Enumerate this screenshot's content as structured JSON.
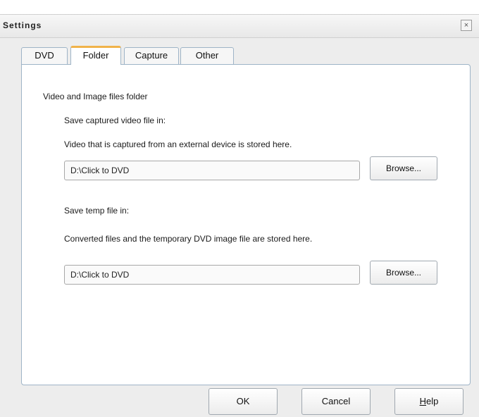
{
  "window": {
    "title": "Settings",
    "close_glyph": "×"
  },
  "tabs": [
    {
      "label": "DVD",
      "active": false
    },
    {
      "label": "Folder",
      "active": true
    },
    {
      "label": "Capture",
      "active": false
    },
    {
      "label": "Other",
      "active": false
    }
  ],
  "folder": {
    "section_title": "Video and Image files folder",
    "capture": {
      "heading": "Save captured video file in:",
      "description": "Video that is captured from an external device is stored here.",
      "path": "D:\\Click to DVD",
      "browse_label": "Browse..."
    },
    "temp": {
      "heading": "Save temp file in:",
      "description": "Converted files and the temporary DVD image file are stored here.",
      "path": "D:\\Click to DVD",
      "browse_label": "Browse..."
    }
  },
  "footer": {
    "ok_label": "OK",
    "cancel_label": "Cancel",
    "help_label_first": "H",
    "help_label_rest": "elp"
  },
  "colors": {
    "active_tab_accent": "#f0b24a",
    "panel_border": "#9eb4c7"
  }
}
